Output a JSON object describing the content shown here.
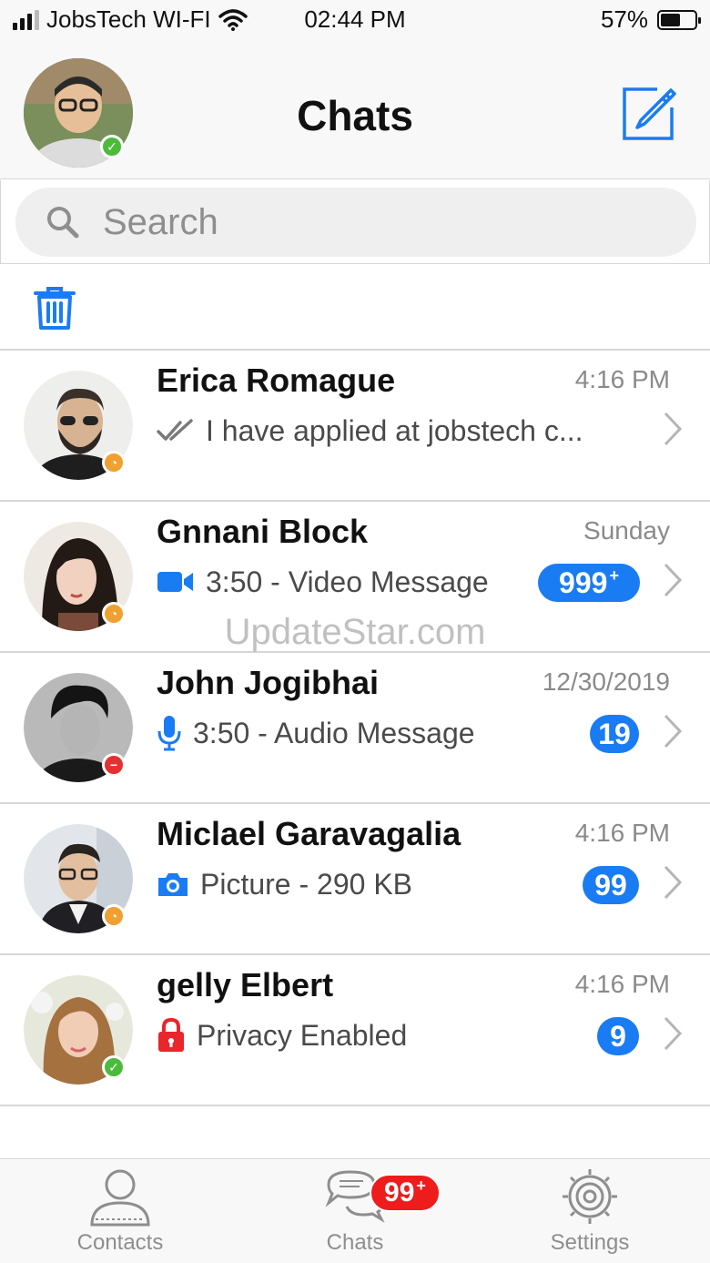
{
  "status_bar": {
    "carrier": "JobsTech WI-FI",
    "time": "02:44 PM",
    "battery_percent": "57%",
    "battery_level": 0.57,
    "signal_bars": 3
  },
  "header": {
    "title": "Chats"
  },
  "search": {
    "placeholder": "Search"
  },
  "chats": [
    {
      "name": "Erica Romague",
      "time": "4:16 PM",
      "preview": "I have applied at jobstech c...",
      "preview_icon": "double-check-icon",
      "badge": "",
      "presence": "away"
    },
    {
      "name": "Gnnani Block",
      "time": "Sunday",
      "preview": "3:50 - Video Message",
      "preview_icon": "video-icon",
      "badge": "999",
      "badge_plus": "+",
      "presence": "away"
    },
    {
      "name": "John Jogibhai",
      "time": "12/30/2019",
      "preview": "3:50 - Audio Message",
      "preview_icon": "microphone-icon",
      "badge": "19",
      "presence": "busy"
    },
    {
      "name": "Miclael Garavagalia",
      "time": "4:16 PM",
      "preview": "Picture - 290 KB",
      "preview_icon": "camera-icon",
      "badge": "99",
      "presence": "away"
    },
    {
      "name": "gelly Elbert",
      "time": "4:16 PM",
      "preview": "Privacy Enabled",
      "preview_icon": "lock-icon",
      "badge": "9",
      "presence": "online"
    }
  ],
  "watermark": "UpdateStar.com",
  "tabs": [
    {
      "label": "Contacts",
      "icon": "person-icon"
    },
    {
      "label": "Chats",
      "icon": "chat-bubbles-icon",
      "badge": "99",
      "badge_plus": "+"
    },
    {
      "label": "Settings",
      "icon": "gear-icon"
    }
  ],
  "colors": {
    "accent": "#1a7cf2",
    "badge_red": "#ee1c1c",
    "online": "#4cbb3c",
    "away": "#f0a030",
    "busy": "#e53030",
    "lock_red": "#e8262c"
  }
}
